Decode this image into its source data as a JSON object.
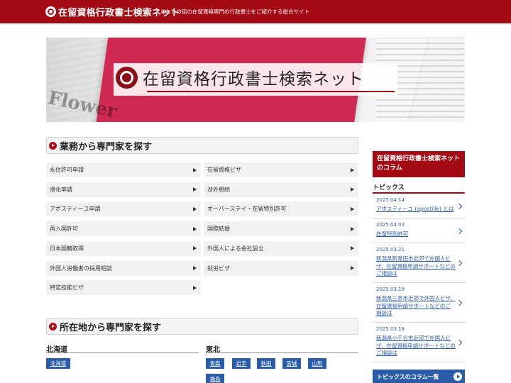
{
  "header": {
    "site_name": "在留資格行政書士検索ネット",
    "tagline": "あなたの街の在留資格専門の行政書士をご紹介する総合サイト"
  },
  "hero": {
    "title": "在留資格行政書士検索ネット",
    "background_word": "Flower"
  },
  "services": {
    "title": "業務から専門家を探す",
    "items": [
      {
        "label": "永住許可申請"
      },
      {
        "label": "在留資格ビザ"
      },
      {
        "label": "帰化申請"
      },
      {
        "label": "渉外相続"
      },
      {
        "label": "アポスティーユ申請"
      },
      {
        "label": "オーバーステイ・在留特別許可"
      },
      {
        "label": "再入国許可"
      },
      {
        "label": "国際結婚"
      },
      {
        "label": "日本国籍取得"
      },
      {
        "label": "外国人による会社設立"
      },
      {
        "label": "外国人労働者の採用相談"
      },
      {
        "label": "就労ビザ"
      },
      {
        "label": "特定技能ビザ"
      }
    ]
  },
  "locations": {
    "title": "所在地から専門家を探す",
    "regions": [
      {
        "name": "北海道",
        "prefectures": [
          "北海道"
        ]
      },
      {
        "name": "東北",
        "prefectures": [
          "青森",
          "岩手",
          "秋田",
          "宮城",
          "山形",
          "福島"
        ]
      }
    ]
  },
  "sidebar": {
    "column_title": "在留資格行政書士検索ネットのコラム",
    "topics_title": "トピックス",
    "topics": [
      {
        "date": "2025.04.14",
        "text": "アポスティーユ (apostille) とは"
      },
      {
        "date": "2025.04.03",
        "text": "在留特別許可"
      },
      {
        "date": "2025.03.21",
        "text": "新潟県新発田市近郊で外国人ビザ、在留資格申請サポートなどのご相談は"
      },
      {
        "date": "2025.03.19",
        "text": "新潟県三条市近郊で外国人ビザ、在留資格申請サポートなどのご相談は"
      },
      {
        "date": "2025.03.18",
        "text": "新潟県小千谷市近郊で外国人ビザ、在留資格申請サポートなどのご相談は"
      }
    ],
    "more_button": "トピックスのコラム一覧"
  },
  "colors": {
    "brand_red": "#a40a14",
    "link_blue": "#2b5ca8"
  }
}
